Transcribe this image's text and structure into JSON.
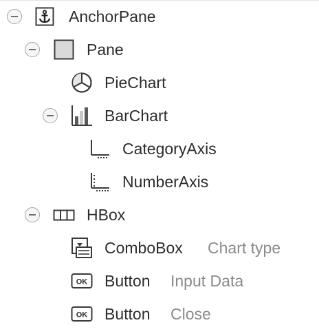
{
  "tree": {
    "nodes": [
      {
        "label": "AnchorPane",
        "icon": "anchor-icon",
        "expanded": true
      },
      {
        "label": "Pane",
        "icon": "pane-icon",
        "expanded": true
      },
      {
        "label": "PieChart",
        "icon": "pie-chart-icon"
      },
      {
        "label": "BarChart",
        "icon": "bar-chart-icon",
        "expanded": true
      },
      {
        "label": "CategoryAxis",
        "icon": "category-axis-icon"
      },
      {
        "label": "NumberAxis",
        "icon": "number-axis-icon"
      },
      {
        "label": "HBox",
        "icon": "hbox-icon",
        "expanded": true
      },
      {
        "label": "ComboBox",
        "icon": "combobox-icon",
        "detail": "Chart type"
      },
      {
        "label": "Button",
        "icon": "button-ok-icon",
        "detail": "Input Data"
      },
      {
        "label": "Button",
        "icon": "button-ok-icon",
        "detail": "Close"
      }
    ]
  },
  "colors": {
    "text": "#2d2d2d",
    "detail_text": "#8a8a8a",
    "icon_stroke": "#3a3a3a",
    "toggle_border": "#a3a3a3"
  }
}
